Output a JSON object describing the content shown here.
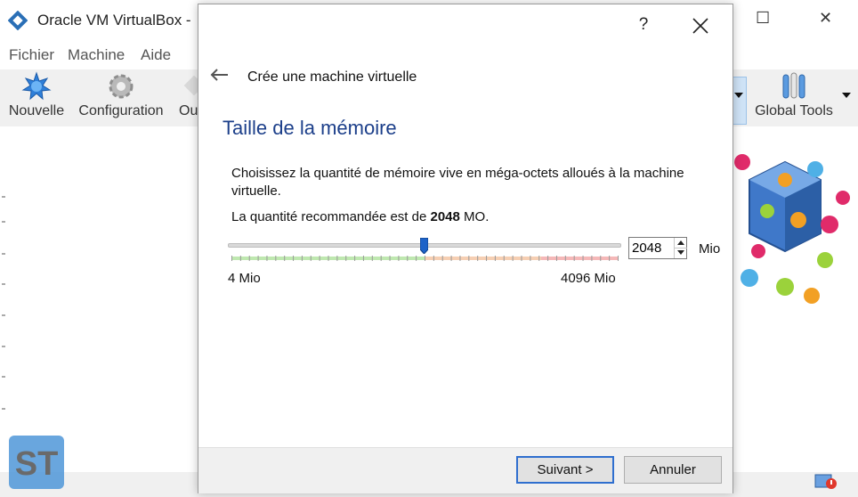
{
  "main_window": {
    "title": "Oracle VM VirtualBox -",
    "controls": {
      "minimize": "–",
      "maximize": "☐",
      "close": "✕"
    },
    "menu": [
      "Fichier",
      "Machine",
      "Aide"
    ],
    "toolbar": {
      "new_label": "Nouvelle",
      "settings_label": "Configuration",
      "partial_label": "Ou",
      "global_tools_label": "Global Tools"
    },
    "watermark": "ST"
  },
  "dialog": {
    "help_glyph": "?",
    "header": "Crée une machine virtuelle",
    "heading": "Taille de la mémoire",
    "description": "Choisissez la quantité de mémoire vive en méga-octets alloués à la machine virtuelle.",
    "recommended_prefix": "La quantité recommandée est de ",
    "recommended_value": "2048",
    "recommended_suffix": " MO.",
    "memory": {
      "value": "2048",
      "unit": "Mio",
      "min_label": "4 Mio",
      "max_label": "4096 Mio",
      "slider_fraction": 0.5
    },
    "buttons": {
      "next": "Suivant >",
      "cancel": "Annuler"
    }
  },
  "colors": {
    "heading": "#1c3f8a",
    "accent_blue": "#2f6fcf",
    "scale_green": "#bfe8b0",
    "scale_orange": "#f6cfb3",
    "scale_red": "#f5b8b8"
  }
}
